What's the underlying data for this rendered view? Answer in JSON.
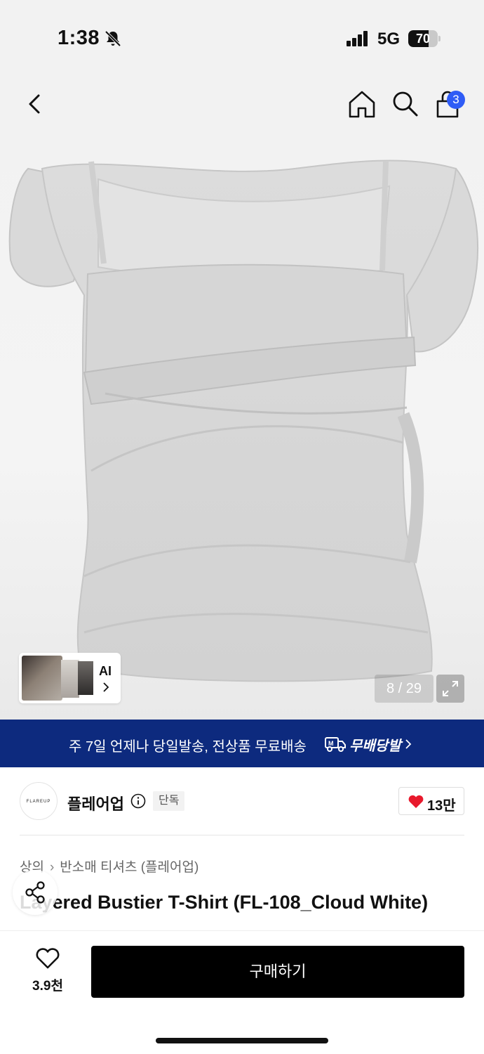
{
  "status_bar": {
    "time": "1:38",
    "network": "5G",
    "battery": "70",
    "battery_level": 0.7
  },
  "nav": {
    "cart_count": "3"
  },
  "gallery": {
    "ai_label": "AI",
    "counter": "8 / 29"
  },
  "shipping_banner": {
    "text": "주 7일 언제나 당일발송, 전상품 무료배송",
    "brand": "무배당발"
  },
  "brand": {
    "logo_text": "FLAREUP",
    "name": "플레어업",
    "badge": "단독",
    "likes": "13만"
  },
  "breadcrumb": [
    "상의",
    "반소매 티셔츠 (플레어업)"
  ],
  "product": {
    "title": "Layered Bustier T-Shirt (FL-108_Cloud White)"
  },
  "bottom_bar": {
    "wish_count": "3.9천",
    "buy_label": "구매하기"
  },
  "colors": {
    "banner": "#0d2a7e",
    "badge": "#2f5cf6",
    "heart": "#e8192c",
    "buy": "#000000"
  }
}
